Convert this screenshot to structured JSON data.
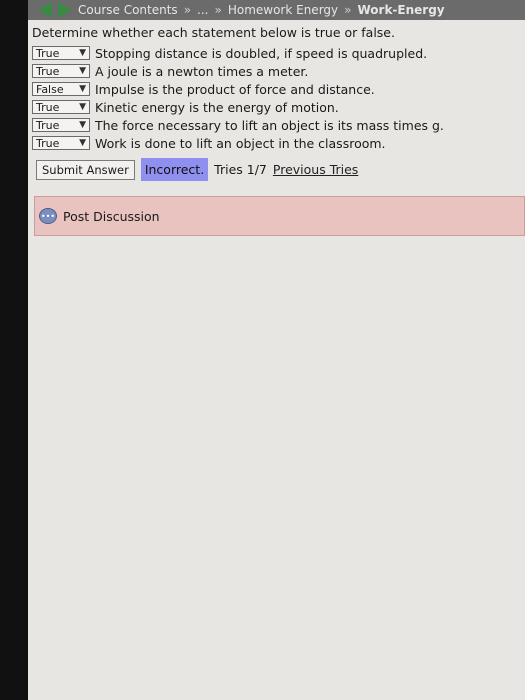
{
  "header": {
    "crumbs": [
      "Course Contents",
      "»",
      "...",
      "»",
      "Homework Energy",
      "»",
      "Work-Energy"
    ]
  },
  "question": {
    "prompt": "Determine whether each statement below is true or false.",
    "statements": [
      {
        "value": "True",
        "text": "Stopping distance is doubled, if speed is quadrupled."
      },
      {
        "value": "True",
        "text": "A joule is a newton times a meter."
      },
      {
        "value": "False",
        "text": "Impulse is the product of force and distance."
      },
      {
        "value": "True",
        "text": "Kinetic energy is the energy of motion."
      },
      {
        "value": "True",
        "text": "The force necessary to lift an object is its mass times g."
      },
      {
        "value": "True",
        "text": "Work is done to lift an object in the classroom."
      }
    ]
  },
  "actions": {
    "submit_label": "Submit Answer",
    "status": "Incorrect.",
    "tries": "Tries 1/7",
    "previous_tries": "Previous Tries"
  },
  "discussion": {
    "label": "Post Discussion"
  },
  "colors": {
    "status_bg": "#8f8ff0",
    "discussion_bg": "#e9c3c0",
    "nav_arrow": "#3a8a44"
  }
}
